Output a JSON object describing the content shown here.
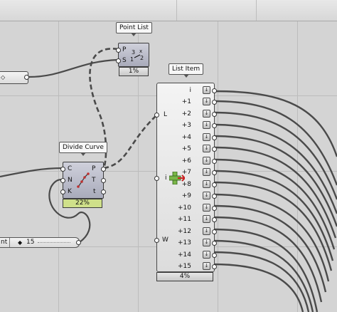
{
  "point_list": {
    "tag": "Point List",
    "inputs": [
      "P",
      "S"
    ],
    "footer": "1%"
  },
  "divide_curve": {
    "tag": "Divide Curve",
    "inputs": [
      "C",
      "N",
      "K"
    ],
    "outputs": [
      "P",
      "T",
      "t"
    ],
    "footer": "22%"
  },
  "list_item": {
    "tag": "List Item",
    "inputs": [
      "L",
      "i",
      "W"
    ],
    "outputs": [
      "i",
      "+1",
      "+2",
      "+3",
      "+4",
      "+5",
      "+6",
      "+7",
      "+8",
      "+9",
      "+10",
      "+11",
      "+12",
      "+13",
      "+14",
      "+15"
    ],
    "footer": "4%"
  },
  "slider": {
    "name_fragment": "nt",
    "value": "15"
  },
  "colors": {
    "canvas": "#d4d4d4",
    "wire": "#4a4a4a",
    "component_fill": "#a9abbb",
    "footer_green": "#cfe08a"
  },
  "icons": [
    "point-list-icon",
    "divide-curve-icon",
    "flatten-cross-icon",
    "arrow-down-icon"
  ]
}
